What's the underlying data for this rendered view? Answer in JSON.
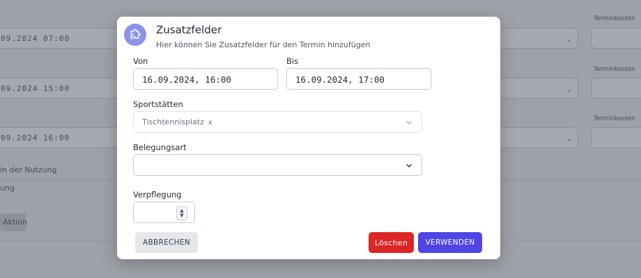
{
  "background": {
    "rows": [
      {
        "value": "09.2024 07:00",
        "label": "Terminkosten"
      },
      {
        "value": "09.2024 15:00",
        "label": "Terminkosten"
      },
      {
        "value": "09.2024 16:00",
        "label": "Terminkosten"
      }
    ],
    "text1": "in der Nutzung",
    "text2": "ung",
    "button_label": "Aktion"
  },
  "modal": {
    "title": "Zusatzfelder",
    "subtitle": "Hier können Sie Zusatzfelder für den Termin hinzufügen",
    "icon": "puzzle-icon",
    "von": {
      "label": "Von",
      "value": "16.09.2024, 16:00"
    },
    "bis": {
      "label": "Bis",
      "value": "16.09.2024, 17:00"
    },
    "sportstaetten": {
      "label": "Sportstätten",
      "selected": "Tischtennisplatz",
      "remove": "x"
    },
    "belegungsart": {
      "label": "Belegungsart",
      "value": ""
    },
    "verpflegung": {
      "label": "Verpflegung",
      "value": ""
    },
    "buttons": {
      "cancel": "ABBRECHEN",
      "delete": "Löschen",
      "apply": "VERWENDEN"
    }
  },
  "colors": {
    "accent": "#4f46e5",
    "danger": "#dc2626",
    "icon_bg": "#8b93e6"
  }
}
